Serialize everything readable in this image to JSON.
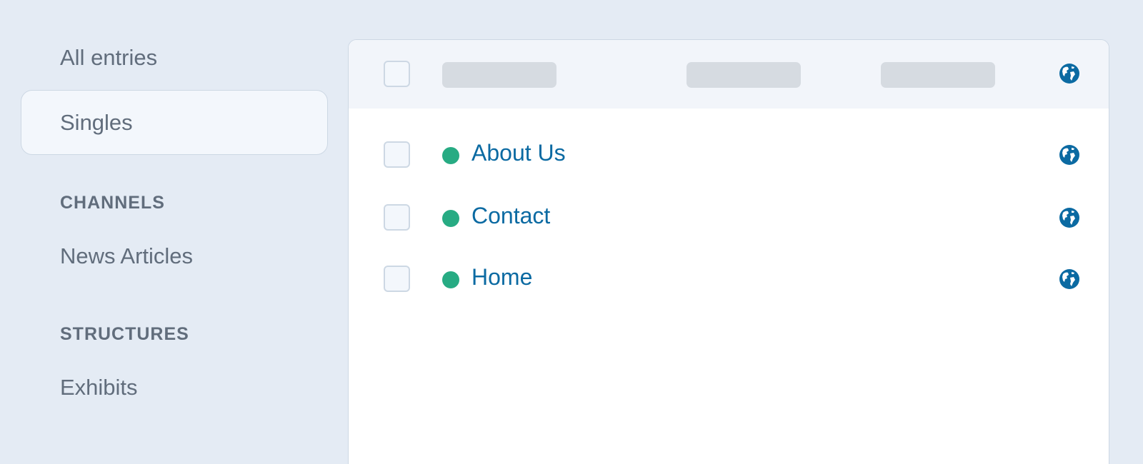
{
  "sidebar": {
    "all_entries": "All entries",
    "singles": "Singles",
    "channels_heading": "CHANNELS",
    "news_articles": "News Articles",
    "structures_heading": "STRUCTURES",
    "exhibits": "Exhibits"
  },
  "table": {
    "rows": [
      {
        "title": "About Us",
        "status": "live"
      },
      {
        "title": "Contact",
        "status": "live"
      },
      {
        "title": "Home",
        "status": "live"
      }
    ]
  },
  "icons": {
    "globe": "globe-icon",
    "status": "status-dot"
  },
  "colors": {
    "background": "#e4ebf4",
    "link": "#0b6aa2",
    "status_live": "#27ab83",
    "sidebar_text": "#616d7c"
  }
}
